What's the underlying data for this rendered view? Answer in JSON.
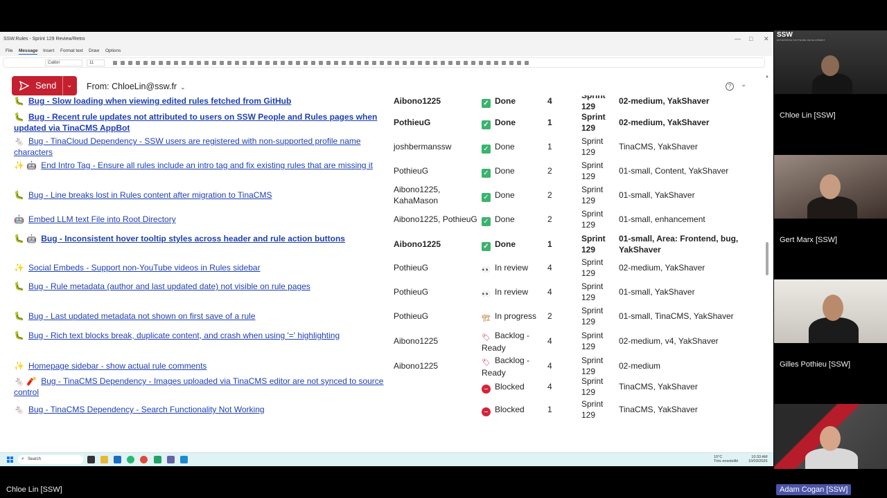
{
  "window": {
    "title": "SSW.Rules - Sprint 129 Review/Retro",
    "controls": [
      "—",
      "□",
      "✕"
    ]
  },
  "menu": {
    "items": [
      "File",
      "Message",
      "Insert",
      "Format text",
      "Draw",
      "Options"
    ],
    "active": "Message"
  },
  "ribbon": {
    "font_name": "Calibri",
    "font_size": "11"
  },
  "compose": {
    "send_label": "Send",
    "from_label": "From: ChloeLin@ssw.fr"
  },
  "rows": [
    {
      "title": "Bug - Slow loading when viewing edited rules fetched from GitHub",
      "emoji": "🐛",
      "assignee": "Aibono1225",
      "status": "Done",
      "status_kind": "done",
      "estimate": "4",
      "sprint": "Sprint 129",
      "labels": "02-medium, YakShaver",
      "bold": true
    },
    {
      "title": "Bug - Recent rule updates not attributed to users on SSW People and Rules pages when updated via TinaCMS AppBot",
      "emoji": "🐛",
      "assignee": "PothieuG",
      "status": "Done",
      "status_kind": "done",
      "estimate": "1",
      "sprint": "Sprint 129",
      "labels": "02-medium, YakShaver",
      "bold": true
    },
    {
      "title": "Bug - TinaCloud Dependency - SSW users are registered with non-supported profile name characters",
      "emoji": "🐁",
      "assignee": "joshbermanssw",
      "status": "Done",
      "status_kind": "done",
      "estimate": "1",
      "sprint": "Sprint 129",
      "labels": "TinaCMS, YakShaver",
      "bold": false
    },
    {
      "title": "End Intro Tag - Ensure all rules include an intro tag and fix existing rules that are missing it",
      "emoji": "✨ 🤖",
      "assignee": "PothieuG",
      "status": "Done",
      "status_kind": "done",
      "estimate": "2",
      "sprint": "Sprint 129",
      "labels": "01-small, Content, YakShaver",
      "bold": false
    },
    {
      "title": "Bug - Line breaks lost in Rules content after migration to TinaCMS",
      "emoji": "🐛",
      "assignee": "Aibono1225, KahaMason",
      "status": "Done",
      "status_kind": "done",
      "estimate": "2",
      "sprint": "Sprint 129",
      "labels": "01-small, YakShaver",
      "bold": false
    },
    {
      "title": "Embed LLM text File into Root Directory",
      "emoji": "🤖",
      "assignee": "Aibono1225, PothieuG",
      "status": "Done",
      "status_kind": "done",
      "estimate": "2",
      "sprint": "Sprint 129",
      "labels": "01-small, enhancement",
      "bold": false
    },
    {
      "title": "Bug - Inconsistent hover tooltip styles across header and rule action buttons",
      "emoji": "🐛 🤖",
      "assignee": "Aibono1225",
      "status": "Done",
      "status_kind": "done",
      "estimate": "1",
      "sprint": "Sprint 129",
      "labels": "01-small, Area: Frontend, bug, YakShaver",
      "bold": true
    },
    {
      "title": "Social Embeds - Support non-YouTube videos in Rules sidebar",
      "emoji": "✨",
      "assignee": "PothieuG",
      "status": "In review",
      "status_kind": "review",
      "estimate": "4",
      "sprint": "Sprint 129",
      "labels": "02-medium, YakShaver",
      "bold": false
    },
    {
      "title": "Bug - Rule metadata (author and last updated date) not visible on rule pages",
      "emoji": "🐛",
      "assignee": "PothieuG",
      "status": "In review",
      "status_kind": "review",
      "estimate": "4",
      "sprint": "Sprint 129",
      "labels": "01-small, YakShaver",
      "bold": false
    },
    {
      "title": "Bug - Last updated metadata not shown on first save of a rule",
      "emoji": "🐛",
      "assignee": "PothieuG",
      "status": "In progress",
      "status_kind": "progress",
      "estimate": "2",
      "sprint": "Sprint 129",
      "labels": "01-small, TinaCMS, YakShaver",
      "bold": false
    },
    {
      "title": "Bug - Rich text blocks break, duplicate content, and crash when using '=' highlighting",
      "emoji": "🐛",
      "assignee": "Aibono1225",
      "status": "Backlog - Ready",
      "status_kind": "backlog",
      "estimate": "4",
      "sprint": "Sprint 129",
      "labels": "02-medium, v4, YakShaver",
      "bold": false
    },
    {
      "title": "Homepage sidebar - show actual rule comments",
      "emoji": "✨",
      "assignee": "Aibono1225",
      "status": "Backlog - Ready",
      "status_kind": "backlog",
      "estimate": "4",
      "sprint": "Sprint 129",
      "labels": "02-medium",
      "bold": false
    },
    {
      "title": "Bug - TinaCMS Dependency - Images uploaded via TinaCMS editor are not synced to source control",
      "emoji": "🐁 🧨",
      "assignee": "",
      "status": "Blocked",
      "status_kind": "blocked",
      "estimate": "4",
      "sprint": "Sprint 129",
      "labels": "TinaCMS, YakShaver",
      "bold": false
    },
    {
      "title": "Bug - TinaCMS Dependency - Search Functionality Not Working",
      "emoji": "🐁",
      "assignee": "",
      "status": "Blocked",
      "status_kind": "blocked",
      "estimate": "1",
      "sprint": "Sprint 129",
      "labels": "TinaCMS, YakShaver",
      "bold": false
    }
  ],
  "taskbar": {
    "search_placeholder": "Search",
    "weather": "10°C",
    "weather_sub": "Très ensoleillé",
    "time": "10:33 AM",
    "date": "10/03/2026"
  },
  "participants": [
    {
      "name": "Chloe Lin [SSW]"
    },
    {
      "name": "Gert Marx [SSW]"
    },
    {
      "name": "Gilles Pothieu [SSW]"
    },
    {
      "name": "Adam Cogan [SSW]"
    }
  ],
  "presenter_name": "Chloe Lin [SSW]",
  "active_speaker": "Adam Cogan [SSW]",
  "logo": {
    "text": "SSW",
    "tagline": "ENTERPRISE SOFTWARE DEVELOPMENT"
  },
  "colors": {
    "send": "#c4202f",
    "link": "#1f3fb0",
    "done": "#3bb36e",
    "blocked": "#d3243b",
    "taskbar": "#dff3f4",
    "speaker_badge": "#4a55a8"
  }
}
